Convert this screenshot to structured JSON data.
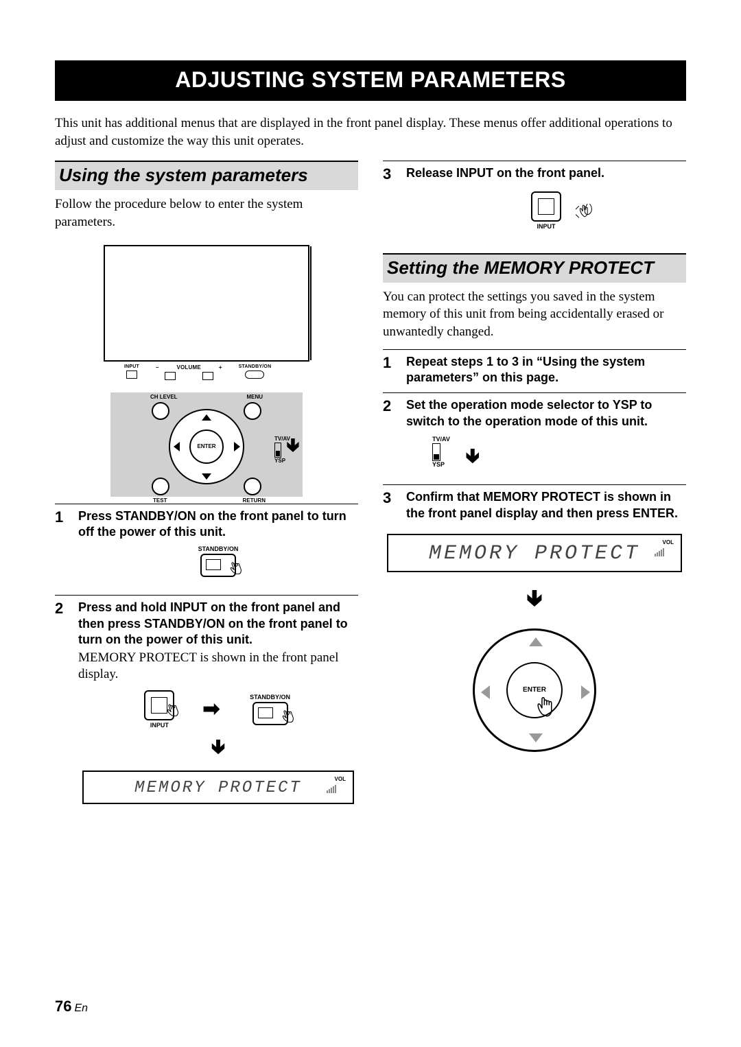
{
  "title": "ADJUSTING SYSTEM PARAMETERS",
  "intro": "This unit has additional menus that are displayed in the front panel display. These menus offer additional operations to adjust and customize the way this unit operates.",
  "left": {
    "heading": "Using the system parameters",
    "lead": "Follow the procedure below to enter the system parameters.",
    "panel_labels": {
      "input": "INPUT",
      "volume": "VOLUME",
      "standby": "STANDBY/ON"
    },
    "remote_labels": {
      "ch_level": "CH LEVEL",
      "menu": "MENU",
      "test": "TEST",
      "return": "RETURN",
      "enter": "ENTER",
      "tvav": "TV/AV",
      "ysp": "YSP"
    },
    "steps": {
      "s1": {
        "num": "1",
        "bold": "Press STANDBY/ON on the front panel to turn off the power of this unit.",
        "btn_label": "STANDBY/ON"
      },
      "s2": {
        "num": "2",
        "bold": "Press and hold INPUT on the front panel and then press STANDBY/ON on the front panel to turn on the power of this unit.",
        "regular": "MEMORY PROTECT is shown in the front panel display.",
        "input_label": "INPUT",
        "standby_label": "STANDBY/ON",
        "lcd_text": "MEMORY PROTECT",
        "lcd_vol": "VOL"
      }
    }
  },
  "right": {
    "step3_heading": {
      "num": "3",
      "bold": "Release INPUT on the front panel.",
      "input_label": "INPUT"
    },
    "section_heading": "Setting the MEMORY PROTECT",
    "lead": "You can protect the settings you saved in the system memory of this unit from being accidentally erased or unwantedly changed.",
    "steps": {
      "s1": {
        "num": "1",
        "bold": "Repeat steps 1 to 3 in “Using the system parameters” on this page."
      },
      "s2": {
        "num": "2",
        "bold": "Set the operation mode selector to YSP to switch to the operation mode of this unit.",
        "tvav": "TV/AV",
        "ysp": "YSP"
      },
      "s3": {
        "num": "3",
        "bold": "Confirm that MEMORY PROTECT is shown in the front panel display and then press ENTER.",
        "lcd_text": "MEMORY PROTECT",
        "lcd_vol": "VOL",
        "enter": "ENTER"
      }
    }
  },
  "page": {
    "number": "76",
    "lang": "En"
  }
}
